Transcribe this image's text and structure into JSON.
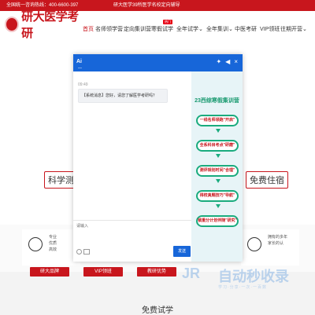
{
  "topbar": {
    "hotline": "全国统一咨询热线：400-6600-397",
    "notice": "研大医学39所医学名校定向辅导"
  },
  "logo": {
    "text": "研大医学考研"
  },
  "nav": {
    "items": [
      "首页",
      "名师领学营",
      "定向集训营",
      "寒假试学",
      "全年试学",
      "全年集训",
      "中医考研",
      "VIP领班",
      "往期开营"
    ],
    "active_index": 0,
    "badges": [
      "",
      "",
      "",
      "热门",
      "",
      "",
      "",
      "",
      ""
    ],
    "chevrons": [
      "",
      "",
      "",
      "",
      "⌄",
      "⌄",
      "",
      "",
      "⌄"
    ]
  },
  "banner": {
    "left_text": "科学测试",
    "right_text": "免费住宿"
  },
  "features": {
    "left_lines": [
      "专业",
      "优质",
      "高效"
    ],
    "right_lines": [
      "拥有的多年",
      "家长的认"
    ],
    "buttons": [
      "研大品牌",
      "VIP领班",
      "教研优势"
    ]
  },
  "footer": {
    "title": "免费试学"
  },
  "watermark": {
    "mark": "JR",
    "text": "自动秒收录",
    "sub": "学习·分享·一次·一百数"
  },
  "chat": {
    "header_logo": "Ai",
    "header_dash": "—",
    "controls": [
      "✦",
      "◀",
      "×"
    ],
    "date": "09:49",
    "bubble": "【系统消息】您好，请您了解医学考研吗？",
    "input_placeholder": "请输入",
    "send_label": "发送",
    "side_title": "23西综寒假集训营",
    "steps": [
      "一线名师领跑\"开启\"",
      "全系科目考点\"研磨\"",
      "测评规划时间\"合理\"",
      "得校真题技巧\"导航\"",
      "锁重分计划伴随\"研究\""
    ]
  },
  "colors": {
    "brand_red": "#c8161d",
    "chat_blue": "#1766d9",
    "step_green": "#1aab7e"
  }
}
